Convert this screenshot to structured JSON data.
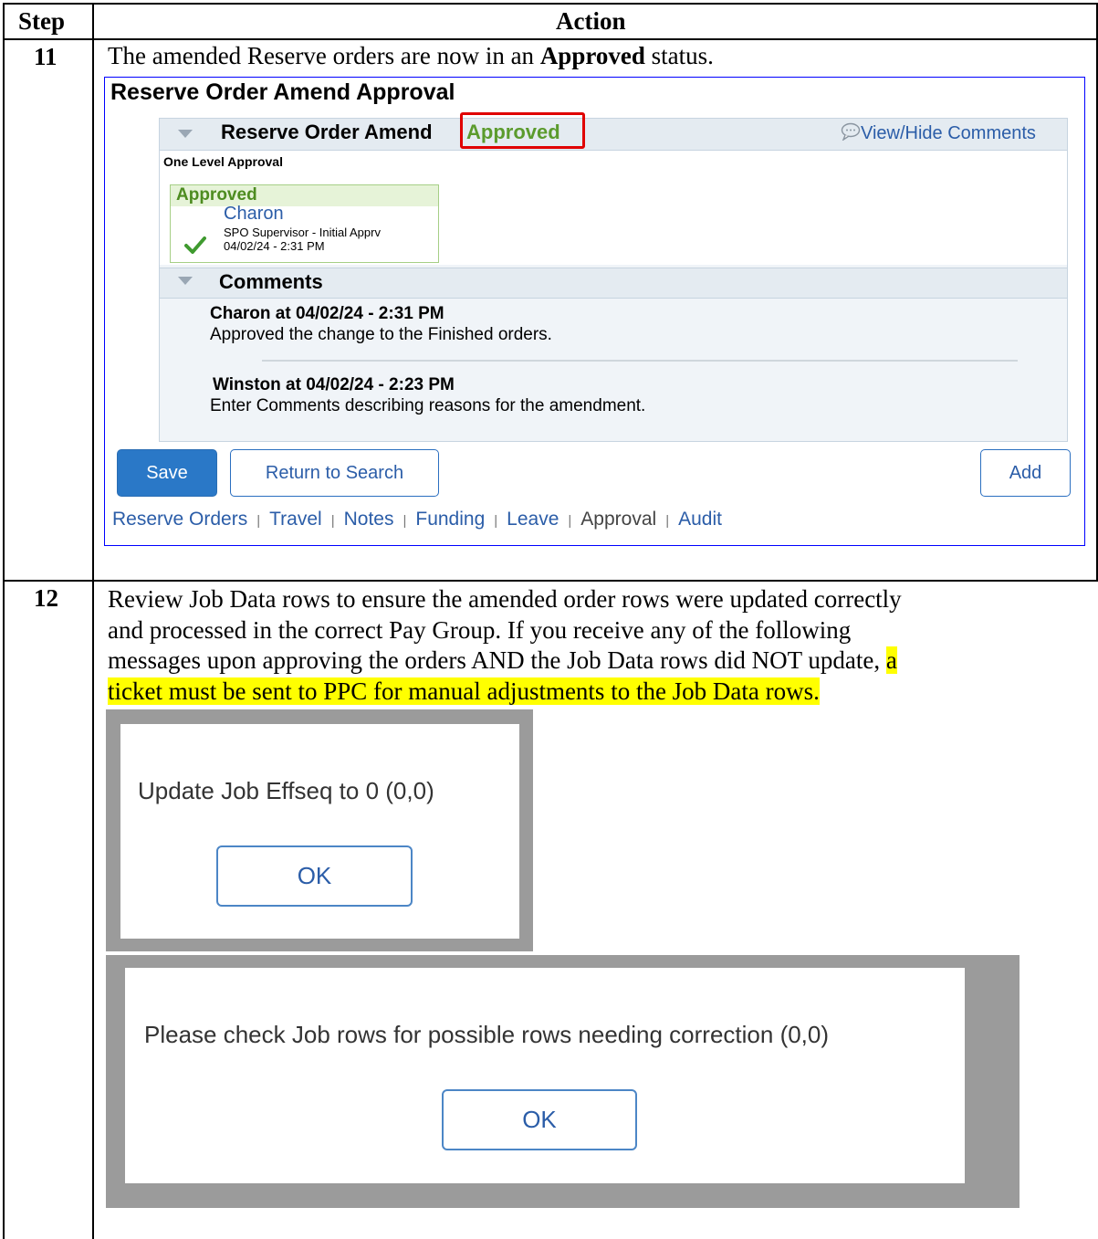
{
  "table": {
    "header_step": "Step",
    "header_action": "Action"
  },
  "step11": {
    "number": "11",
    "text_before": "The amended Reserve orders are now in an ",
    "text_bold": "Approved",
    "text_after": " status."
  },
  "panel": {
    "page_title": "Reserve Order Amend Approval",
    "section_title": "Reserve Order Amend",
    "status": "Approved",
    "view_hide": "View/Hide Comments",
    "approval_type": "One Level Approval",
    "approver": {
      "status": "Approved",
      "name": "Charon",
      "role": "SPO Supervisor - Initial Apprv",
      "datetime": "04/02/24 - 2:31 PM"
    },
    "comments_title": "Comments",
    "comments": [
      {
        "author": "Charon at 04/02/24 - 2:31 PM",
        "text": "Approved the change to the Finished orders."
      },
      {
        "author": "Winston at 04/02/24 - 2:23 PM",
        "text": "Enter Comments describing reasons for the amendment."
      }
    ],
    "buttons": {
      "save": "Save",
      "return": "Return to Search",
      "add": "Add"
    },
    "links": [
      "Reserve Orders",
      "Travel",
      "Notes",
      "Funding",
      "Leave",
      "Approval",
      "Audit"
    ],
    "link_separator": "|"
  },
  "step12": {
    "number": "12",
    "lines": [
      "Review Job Data rows to ensure the amended order rows were updated correctly",
      "and processed in the correct Pay Group. If you receive any of the following",
      "messages upon approving the orders AND the Job Data rows did NOT update, "
    ],
    "highlight_1": "a",
    "highlight_2": "ticket must be sent to PPC for manual adjustments to the Job Data rows."
  },
  "dialogs": [
    {
      "message": "Update Job Effseq to 0 (0,0)",
      "button": "OK"
    },
    {
      "message": "Please check Job rows for possible rows needing correction (0,0)",
      "button": "OK"
    }
  ],
  "colors": {
    "approved_green": "#5b9b2d",
    "link_blue": "#2b5da8",
    "primary_button": "#2a78c7",
    "highlight": "#ffff00",
    "red_outline": "#e00000"
  },
  "icons": [
    "expand-triangle-icon",
    "comment-bubble-icon",
    "checkmark-icon"
  ]
}
